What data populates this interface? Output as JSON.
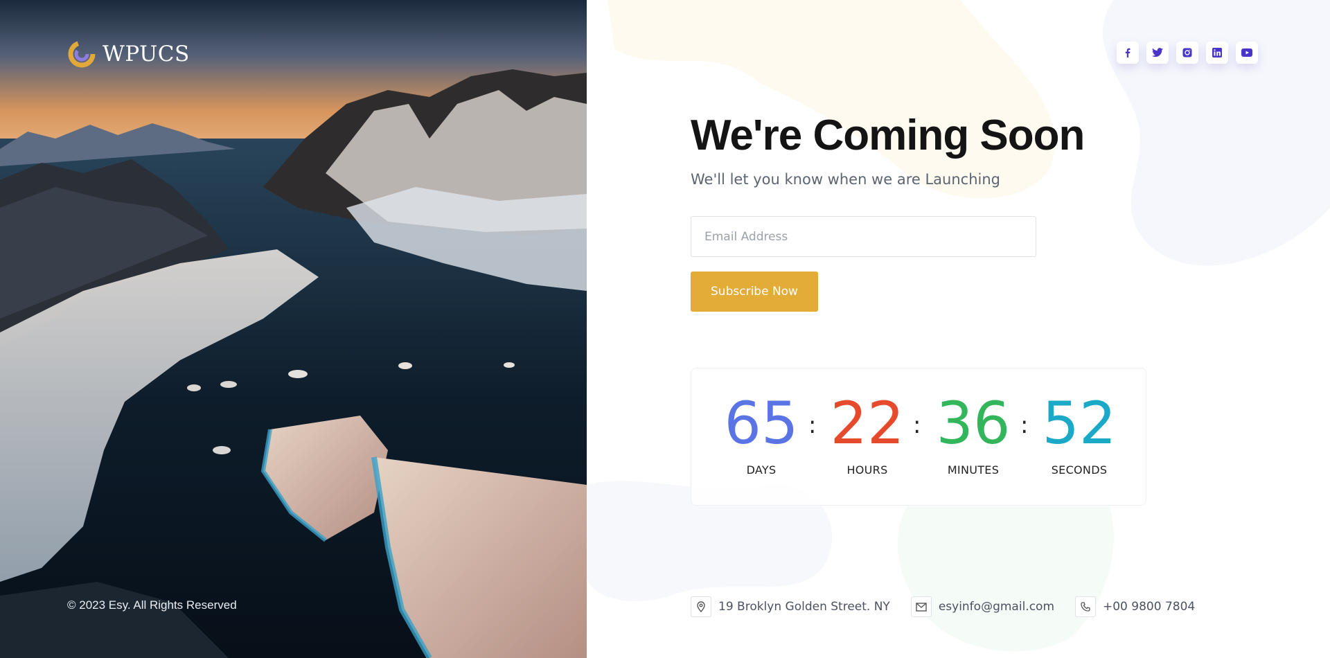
{
  "brand": {
    "name": "WPUCS"
  },
  "footer": {
    "copyright": "© 2023 Esy. All Rights Reserved"
  },
  "social": [
    {
      "name": "facebook-icon",
      "glyph": "f"
    },
    {
      "name": "twitter-icon",
      "glyph": "t"
    },
    {
      "name": "instagram-icon",
      "glyph": "i"
    },
    {
      "name": "linkedin-icon",
      "glyph": "in"
    },
    {
      "name": "youtube-icon",
      "glyph": "y"
    }
  ],
  "hero": {
    "title": "We're Coming Soon",
    "subtitle": "We'll let you know when we are Launching"
  },
  "form": {
    "email_placeholder": "Email Address",
    "subscribe_label": "Subscribe Now"
  },
  "countdown": {
    "days": {
      "value": "65",
      "label": "DAYS",
      "color": "#5a74e6"
    },
    "hours": {
      "value": "22",
      "label": "HOURS",
      "color": "#e54a2c"
    },
    "minutes": {
      "value": "36",
      "label": "MINUTES",
      "color": "#33b55c"
    },
    "seconds": {
      "value": "52",
      "label": "SECONDS",
      "color": "#1aa9c6"
    },
    "separator": ":"
  },
  "contact": {
    "address": "19 Broklyn Golden Street. NY",
    "email": "esyinfo@gmail.com",
    "phone": "+00 9800 7804"
  },
  "colors": {
    "accent": "#e3ac36",
    "social_icon": "#4a35c9"
  }
}
